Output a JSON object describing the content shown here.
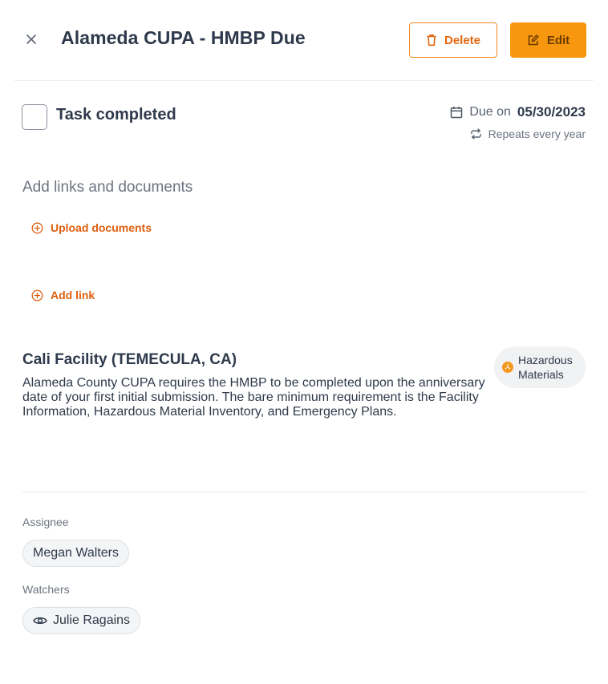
{
  "header": {
    "title": "Alameda CUPA - HMBP Due",
    "delete_label": "Delete",
    "edit_label": "Edit"
  },
  "task": {
    "completed_label": "Task completed",
    "completed": false,
    "due_prefix": "Due on",
    "due_date": "05/30/2023",
    "repeat_text": "Repeats every year"
  },
  "links": {
    "heading": "Add links and documents",
    "upload_label": "Upload documents",
    "add_link_label": "Add link"
  },
  "facility": {
    "name": "Cali Facility (TEMECULA, CA)",
    "description": "Alameda County CUPA requires the HMBP to be completed upon the anniversary date of your first initial submission. The bare minimum requirement is the Facility Information, Hazardous Material Inventory, and Emergency Plans.",
    "category_line1": "Hazardous",
    "category_line2": "Materials"
  },
  "people": {
    "assignee_label": "Assignee",
    "assignee_name": "Megan Walters",
    "watchers_label": "Watchers",
    "watcher_name": "Julie Ragains"
  },
  "colors": {
    "accent": "#f7970f",
    "accent_text": "#dd5f0f",
    "hazard": "#f39a1e"
  }
}
